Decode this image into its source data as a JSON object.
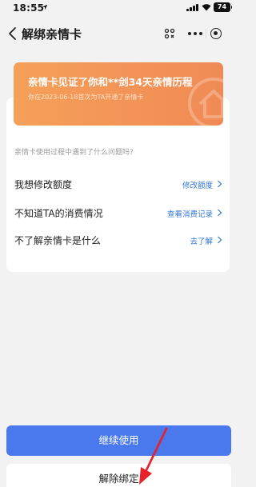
{
  "status_bar": {
    "time": "18:55",
    "battery": "74"
  },
  "nav": {
    "title": "解绑亲情卡"
  },
  "banner": {
    "title": "亲情卡见证了你和**剑34天亲情历程",
    "subtitle": "你在2023-06-18首次为TA开通了亲情卡"
  },
  "question": "亲情卡使用过程中遇到了什么问题吗?",
  "options": [
    {
      "label": "我想修改额度",
      "link": "修改额度"
    },
    {
      "label": "不知道TA的消费情况",
      "link": "查看消费记录"
    },
    {
      "label": "不了解亲情卡是什么",
      "link": "去了解"
    }
  ],
  "buttons": {
    "continue": "继续使用",
    "unbind": "解除绑定"
  },
  "colors": {
    "primary": "#4979ec",
    "link": "#3576d8",
    "banner": "#f5a059",
    "annotation": "#e8202a"
  }
}
